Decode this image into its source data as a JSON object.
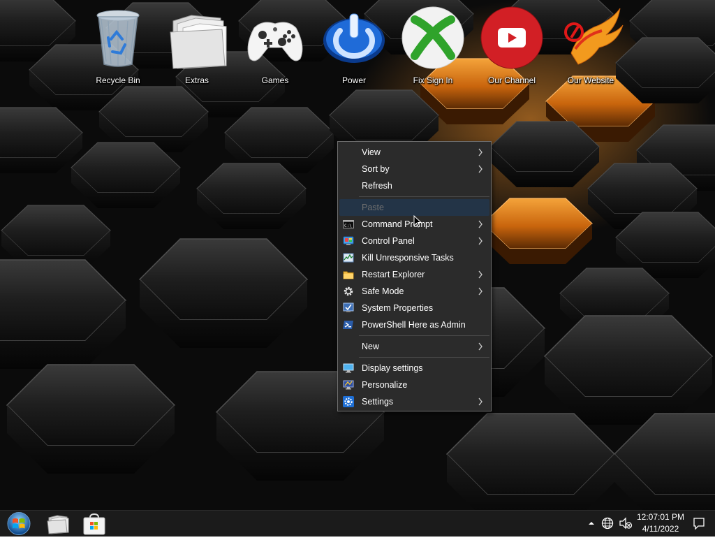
{
  "desktop": {
    "icons": [
      {
        "label": "Recycle Bin",
        "icon": "recycle-bin-icon"
      },
      {
        "label": "Extras",
        "icon": "folder-icon"
      },
      {
        "label": "Games",
        "icon": "game-controller-icon"
      },
      {
        "label": "Power",
        "icon": "power-icon"
      },
      {
        "label": "Fix Sign In",
        "icon": "xbox-icon"
      },
      {
        "label": "Our Channel",
        "icon": "youtube-icon"
      },
      {
        "label": "Our Website",
        "icon": "phoenix-logo-icon"
      }
    ]
  },
  "context_menu": {
    "items": [
      {
        "label": "View",
        "submenu": true
      },
      {
        "label": "Sort by",
        "submenu": true
      },
      {
        "label": "Refresh",
        "submenu": false
      },
      {
        "label": "Paste",
        "submenu": false,
        "disabled": true
      },
      {
        "label": "Command Prompt",
        "submenu": true,
        "icon": "command-prompt-icon"
      },
      {
        "label": "Control Panel",
        "submenu": true,
        "icon": "control-panel-icon"
      },
      {
        "label": "Kill Unresponsive Tasks",
        "submenu": false,
        "icon": "task-manager-icon"
      },
      {
        "label": "Restart Explorer",
        "submenu": true,
        "icon": "folder-icon"
      },
      {
        "label": "Safe Mode",
        "submenu": true,
        "icon": "gear-icon"
      },
      {
        "label": "System Properties",
        "submenu": false,
        "icon": "system-properties-icon"
      },
      {
        "label": "PowerShell Here as Admin",
        "submenu": false,
        "icon": "powershell-icon"
      },
      {
        "label": "New",
        "submenu": true
      },
      {
        "label": "Display settings",
        "submenu": false,
        "icon": "display-icon"
      },
      {
        "label": "Personalize",
        "submenu": false,
        "icon": "personalize-icon"
      },
      {
        "label": "Settings",
        "submenu": true,
        "icon": "settings-gear-icon"
      }
    ]
  },
  "taskbar": {
    "pinned": [
      {
        "name": "start-button",
        "icon": "windows-orb-icon"
      },
      {
        "name": "file-explorer-button",
        "icon": "file-explorer-icon"
      },
      {
        "name": "store-button",
        "icon": "store-icon"
      }
    ],
    "tray": {
      "time": "12:07:01 PM",
      "date": "4/11/2022",
      "icons": [
        "chevron-up-icon",
        "network-icon",
        "volume-muted-icon",
        "notification-icon"
      ]
    }
  },
  "colors": {
    "menu_bg": "#2b2b2b",
    "menu_border": "#6e6e6e",
    "menu_highlight": "#233447",
    "taskbar_bg": "#1b1b1b",
    "accent_orange": "#f08a1e"
  }
}
